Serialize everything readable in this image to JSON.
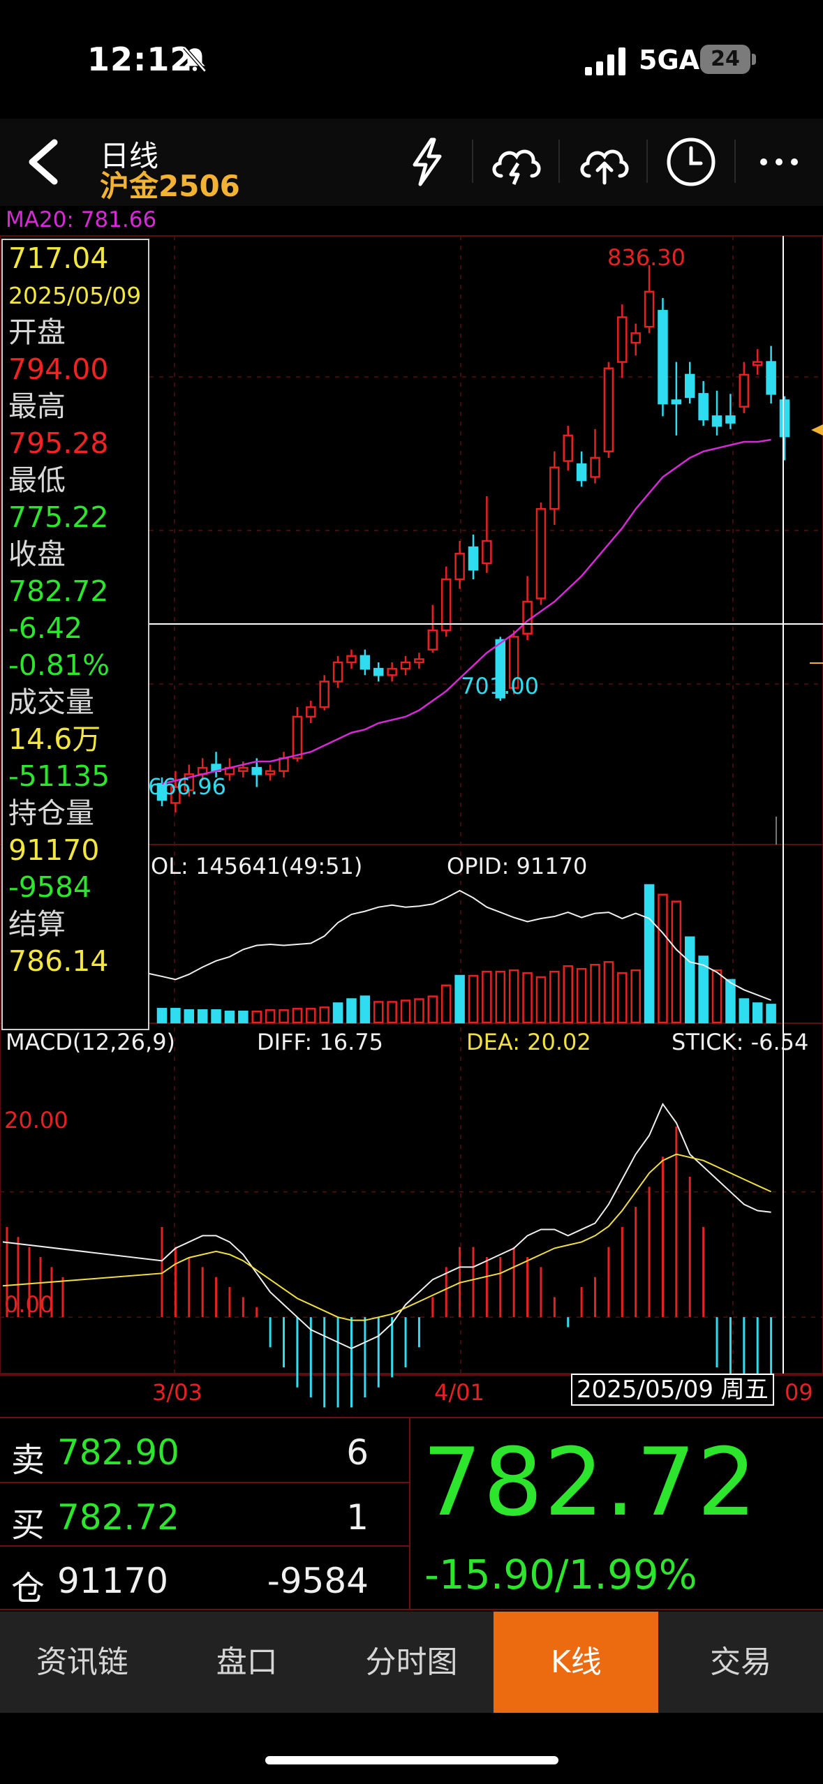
{
  "status": {
    "time": "12:12",
    "network": "5GA",
    "battery": "24"
  },
  "header": {
    "title": "日线",
    "subtitle": "沪金2506"
  },
  "ma_label": "MA20: 781.66",
  "info_panel": {
    "price": "717.04",
    "date": "2025/05/09",
    "open_label": "开盘",
    "open": "794.00",
    "high_label": "最高",
    "high": "795.28",
    "low_label": "最低",
    "low": "775.22",
    "close_label": "收盘",
    "close": "782.72",
    "change": "-6.42",
    "change_pct": "-0.81%",
    "volume_label": "成交量",
    "volume": "14.6万",
    "volume_chg": "-51135",
    "oi_label": "持仓量",
    "oi": "91170",
    "oi_chg": "-9584",
    "settle_label": "结算",
    "settle": "786.14"
  },
  "annotations": {
    "high_label": "836.30",
    "mid_low": "701.00",
    "low_label": "666.96",
    "vol_label": "OL: 145641(49:51)",
    "opid_label": "OPID: 91170",
    "macd_label": "MACD(12,26,9)",
    "diff_label": "DIFF: 16.75",
    "dea_label": "DEA: 20.02",
    "stick_label": "STICK: -6.54",
    "macd_level": "20.00",
    "macd_zero": "0.00",
    "x_tick_1": "3/03",
    "x_tick_2": "4/01",
    "x_tick_end": "09",
    "crosshair_date": "2025/05/09 周五"
  },
  "quote": {
    "sell_label": "卖",
    "sell_price": "782.90",
    "sell_vol": "6",
    "buy_label": "买",
    "buy_price": "782.72",
    "buy_vol": "1",
    "oi_label": "仓",
    "oi": "91170",
    "oi_chg": "-9584",
    "last": "782.72",
    "change": "-15.90/1.99%"
  },
  "tabs": [
    "资讯链",
    "盘口",
    "分时图",
    "K线",
    "交易"
  ],
  "colors": {
    "up": "#e52222",
    "down": "#2fdcf0",
    "ma": "#d62ad6",
    "accent": "#ec6a10",
    "gold": "#f2b233"
  },
  "chart_data": [
    {
      "type": "candlestick",
      "title": "日线 沪金2506",
      "series_ma": "MA20",
      "ma20_last": 781.66,
      "annotated_high": 836.3,
      "annotated_low": 666.96,
      "annotated_local_low": 701.0,
      "candles": [
        {
          "o": 674,
          "c": 669,
          "h": 676,
          "l": 667
        },
        {
          "o": 668,
          "c": 673,
          "h": 678,
          "l": 665
        },
        {
          "o": 672,
          "c": 677,
          "h": 680,
          "l": 670
        },
        {
          "o": 677,
          "c": 679,
          "h": 682,
          "l": 675
        },
        {
          "o": 680,
          "c": 678,
          "h": 684,
          "l": 676
        },
        {
          "o": 677,
          "c": 679,
          "h": 682,
          "l": 675
        },
        {
          "o": 678,
          "c": 679,
          "h": 681,
          "l": 676
        },
        {
          "o": 679,
          "c": 677,
          "h": 682,
          "l": 673
        },
        {
          "o": 677,
          "c": 678,
          "h": 680,
          "l": 675
        },
        {
          "o": 678,
          "c": 682,
          "h": 684,
          "l": 676
        },
        {
          "o": 682,
          "c": 695,
          "h": 698,
          "l": 681
        },
        {
          "o": 695,
          "c": 698,
          "h": 700,
          "l": 693
        },
        {
          "o": 698,
          "c": 706,
          "h": 708,
          "l": 697
        },
        {
          "o": 706,
          "c": 712,
          "h": 714,
          "l": 704
        },
        {
          "o": 712,
          "c": 714,
          "h": 716,
          "l": 710
        },
        {
          "o": 714,
          "c": 710,
          "h": 716,
          "l": 708
        },
        {
          "o": 710,
          "c": 708,
          "h": 712,
          "l": 706
        },
        {
          "o": 708,
          "c": 710,
          "h": 712,
          "l": 706
        },
        {
          "o": 710,
          "c": 712,
          "h": 714,
          "l": 708
        },
        {
          "o": 712,
          "c": 713,
          "h": 715,
          "l": 710
        },
        {
          "o": 716,
          "c": 722,
          "h": 730,
          "l": 715
        },
        {
          "o": 722,
          "c": 738,
          "h": 742,
          "l": 720
        },
        {
          "o": 738,
          "c": 746,
          "h": 750,
          "l": 735
        },
        {
          "o": 748,
          "c": 741,
          "h": 752,
          "l": 738
        },
        {
          "o": 743,
          "c": 750,
          "h": 764,
          "l": 740
        },
        {
          "o": 719,
          "c": 701,
          "h": 720,
          "l": 700
        },
        {
          "o": 704,
          "c": 720,
          "h": 722,
          "l": 702
        },
        {
          "o": 721,
          "c": 731,
          "h": 739,
          "l": 719
        },
        {
          "o": 732,
          "c": 760,
          "h": 762,
          "l": 730
        },
        {
          "o": 760,
          "c": 773,
          "h": 778,
          "l": 755
        },
        {
          "o": 775,
          "c": 783,
          "h": 786,
          "l": 772
        },
        {
          "o": 774,
          "c": 769,
          "h": 778,
          "l": 767
        },
        {
          "o": 770,
          "c": 776,
          "h": 785,
          "l": 768
        },
        {
          "o": 778,
          "c": 804,
          "h": 806,
          "l": 776
        },
        {
          "o": 806,
          "c": 820,
          "h": 824,
          "l": 801
        },
        {
          "o": 812,
          "c": 815,
          "h": 818,
          "l": 808
        },
        {
          "o": 817,
          "c": 828,
          "h": 836.3,
          "l": 815
        },
        {
          "o": 822,
          "c": 793,
          "h": 826,
          "l": 789
        },
        {
          "o": 794,
          "c": 793,
          "h": 806,
          "l": 783
        },
        {
          "o": 802,
          "c": 795,
          "h": 806,
          "l": 793
        },
        {
          "o": 796,
          "c": 788,
          "h": 800,
          "l": 786
        },
        {
          "o": 789,
          "c": 786,
          "h": 797,
          "l": 783
        },
        {
          "o": 789,
          "c": 787,
          "h": 796,
          "l": 785
        },
        {
          "o": 792,
          "c": 802,
          "h": 806,
          "l": 790
        },
        {
          "o": 805,
          "c": 806,
          "h": 810,
          "l": 802
        },
        {
          "o": 806,
          "c": 796,
          "h": 811,
          "l": 793
        },
        {
          "o": 794,
          "c": 782.72,
          "h": 795.28,
          "l": 775.22
        }
      ],
      "ma20": [
        674,
        675,
        676,
        677,
        678,
        679,
        680,
        681,
        681,
        682,
        683,
        684,
        686,
        688,
        690,
        691,
        693,
        694,
        695,
        697,
        700,
        703,
        707,
        711,
        715,
        718,
        721,
        725,
        728,
        731,
        735,
        739,
        744,
        749,
        754,
        760,
        765,
        770,
        773,
        776,
        778,
        779,
        780,
        781,
        781,
        781.66
      ]
    },
    {
      "type": "bar",
      "title": "OL: 145641(49:51)",
      "volume_up_down": [
        "d",
        "d",
        "d",
        "d",
        "d",
        "d",
        "d",
        "u",
        "u",
        "u",
        "u",
        "u",
        "u",
        "d",
        "d",
        "d",
        "u",
        "u",
        "u",
        "u",
        "u",
        "u",
        "d",
        "u",
        "u",
        "u",
        "u",
        "u",
        "u",
        "u",
        "u",
        "u",
        "u",
        "u",
        "u",
        "u",
        "d",
        "u",
        "u",
        "d",
        "d",
        "u",
        "d",
        "d",
        "d",
        "d"
      ],
      "volume": [
        10,
        10,
        9,
        9,
        9,
        8,
        8,
        8,
        9,
        9,
        10,
        10,
        11,
        14,
        17,
        19,
        15,
        15,
        16,
        17,
        19,
        27,
        34,
        34,
        37,
        37,
        38,
        36,
        33,
        37,
        41,
        39,
        42,
        44,
        36,
        38,
        100,
        93,
        88,
        62,
        48,
        38,
        31,
        17,
        14,
        13
      ],
      "open_interest_label": "OPID: 91170",
      "open_interest": [
        71,
        68,
        73,
        80,
        86,
        90,
        97,
        101,
        102,
        101,
        102,
        103,
        110,
        123,
        131,
        134,
        138,
        140,
        138,
        139,
        141,
        147,
        154,
        147,
        138,
        133,
        128,
        124,
        127,
        129,
        133,
        128,
        132,
        133,
        127,
        132,
        127,
        113,
        97,
        85,
        82,
        75,
        65,
        58,
        53,
        48
      ]
    },
    {
      "type": "line",
      "title": "MACD(12,26,9)",
      "diff_last": 16.75,
      "dea_last": 20.02,
      "stick_last": -6.54,
      "diff": [
        9,
        11,
        12,
        13,
        13,
        12,
        10,
        7,
        4,
        2,
        0,
        -2,
        -3,
        -4,
        -5,
        -4,
        -3,
        -1,
        2,
        4,
        6,
        7,
        8,
        8,
        9,
        10,
        11,
        13,
        14,
        14,
        13,
        14,
        15,
        18,
        22,
        26,
        29,
        34,
        31,
        26,
        24,
        22,
        20,
        18,
        17,
        16.75
      ],
      "dea": [
        7,
        8.5,
        9.5,
        10,
        10.5,
        10,
        9,
        7.5,
        6,
        4.5,
        3,
        2,
        1,
        0,
        -0.5,
        -0.5,
        0,
        0.5,
        1.5,
        2.5,
        3.5,
        4.5,
        5.5,
        6,
        6.5,
        7,
        8,
        9,
        10,
        11,
        11.5,
        12,
        13,
        14.5,
        17,
        20,
        23,
        25,
        26,
        25.5,
        25,
        24,
        23,
        22,
        21,
        20.02
      ],
      "stick": [
        9,
        7,
        6,
        5,
        4,
        3,
        2,
        1,
        -3,
        -5,
        -7,
        -8,
        -9,
        -9,
        -9,
        -8,
        -7,
        -6,
        -5,
        -3,
        2,
        5,
        7,
        7,
        6,
        6,
        7,
        6,
        5,
        2,
        -1,
        3,
        4,
        7,
        9,
        11,
        13,
        16,
        19,
        14,
        9,
        -5,
        -7,
        -7,
        -8,
        -6.54
      ]
    }
  ]
}
